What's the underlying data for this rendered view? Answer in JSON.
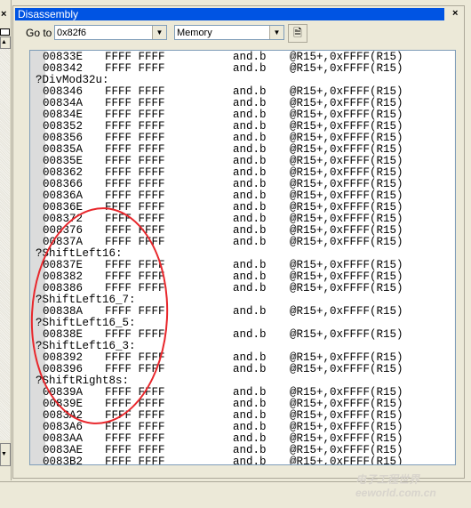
{
  "window": {
    "title": "Disassembly"
  },
  "toolbar": {
    "goto_label": "Go to",
    "goto_value": "0x82f6",
    "view_value": "Memory"
  },
  "colors": {
    "title_bar": "#0054e3",
    "annotation": "#e8262b"
  },
  "watermark": "eeworld.com.cn",
  "rows": [
    {
      "addr": "00833E",
      "hex": "FFFF FFFF",
      "op": "and.b",
      "args": "@R15+,0xFFFF(R15)"
    },
    {
      "addr": "008342",
      "hex": "FFFF FFFF",
      "op": "and.b",
      "args": "@R15+,0xFFFF(R15)"
    },
    {
      "label": "?DivMod32u:"
    },
    {
      "addr": "008346",
      "hex": "FFFF FFFF",
      "op": "and.b",
      "args": "@R15+,0xFFFF(R15)"
    },
    {
      "addr": "00834A",
      "hex": "FFFF FFFF",
      "op": "and.b",
      "args": "@R15+,0xFFFF(R15)"
    },
    {
      "addr": "00834E",
      "hex": "FFFF FFFF",
      "op": "and.b",
      "args": "@R15+,0xFFFF(R15)"
    },
    {
      "addr": "008352",
      "hex": "FFFF FFFF",
      "op": "and.b",
      "args": "@R15+,0xFFFF(R15)"
    },
    {
      "addr": "008356",
      "hex": "FFFF FFFF",
      "op": "and.b",
      "args": "@R15+,0xFFFF(R15)"
    },
    {
      "addr": "00835A",
      "hex": "FFFF FFFF",
      "op": "and.b",
      "args": "@R15+,0xFFFF(R15)"
    },
    {
      "addr": "00835E",
      "hex": "FFFF FFFF",
      "op": "and.b",
      "args": "@R15+,0xFFFF(R15)"
    },
    {
      "addr": "008362",
      "hex": "FFFF FFFF",
      "op": "and.b",
      "args": "@R15+,0xFFFF(R15)"
    },
    {
      "addr": "008366",
      "hex": "FFFF FFFF",
      "op": "and.b",
      "args": "@R15+,0xFFFF(R15)"
    },
    {
      "addr": "00836A",
      "hex": "FFFF FFFF",
      "op": "and.b",
      "args": "@R15+,0xFFFF(R15)"
    },
    {
      "addr": "00836E",
      "hex": "FFFF FFFF",
      "op": "and.b",
      "args": "@R15+,0xFFFF(R15)"
    },
    {
      "addr": "008372",
      "hex": "FFFF FFFF",
      "op": "and.b",
      "args": "@R15+,0xFFFF(R15)"
    },
    {
      "addr": "008376",
      "hex": "FFFF FFFF",
      "op": "and.b",
      "args": "@R15+,0xFFFF(R15)"
    },
    {
      "addr": "00837A",
      "hex": "FFFF FFFF",
      "op": "and.b",
      "args": "@R15+,0xFFFF(R15)"
    },
    {
      "label": "?ShiftLeft16:"
    },
    {
      "addr": "00837E",
      "hex": "FFFF FFFF",
      "op": "and.b",
      "args": "@R15+,0xFFFF(R15)"
    },
    {
      "addr": "008382",
      "hex": "FFFF FFFF",
      "op": "and.b",
      "args": "@R15+,0xFFFF(R15)"
    },
    {
      "addr": "008386",
      "hex": "FFFF FFFF",
      "op": "and.b",
      "args": "@R15+,0xFFFF(R15)"
    },
    {
      "label": "?ShiftLeft16_7:"
    },
    {
      "addr": "00838A",
      "hex": "FFFF FFFF",
      "op": "and.b",
      "args": "@R15+,0xFFFF(R15)"
    },
    {
      "label": "?ShiftLeft16_5:"
    },
    {
      "addr": "00838E",
      "hex": "FFFF FFFF",
      "op": "and.b",
      "args": "@R15+,0xFFFF(R15)"
    },
    {
      "label": "?ShiftLeft16_3:"
    },
    {
      "addr": "008392",
      "hex": "FFFF FFFF",
      "op": "and.b",
      "args": "@R15+,0xFFFF(R15)"
    },
    {
      "addr": "008396",
      "hex": "FFFF FFFF",
      "op": "and.b",
      "args": "@R15+,0xFFFF(R15)"
    },
    {
      "label": "?ShiftRight8s:"
    },
    {
      "addr": "00839A",
      "hex": "FFFF FFFF",
      "op": "and.b",
      "args": "@R15+,0xFFFF(R15)"
    },
    {
      "addr": "00839E",
      "hex": "FFFF FFFF",
      "op": "and.b",
      "args": "@R15+,0xFFFF(R15)"
    },
    {
      "addr": "0083A2",
      "hex": "FFFF FFFF",
      "op": "and.b",
      "args": "@R15+,0xFFFF(R15)"
    },
    {
      "addr": "0083A6",
      "hex": "FFFF FFFF",
      "op": "and.b",
      "args": "@R15+,0xFFFF(R15)"
    },
    {
      "addr": "0083AA",
      "hex": "FFFF FFFF",
      "op": "and.b",
      "args": "@R15+,0xFFFF(R15)"
    },
    {
      "addr": "0083AE",
      "hex": "FFFF FFFF",
      "op": "and.b",
      "args": "@R15+,0xFFFF(R15)"
    },
    {
      "addr": "0083B2",
      "hex": "FFFF FFFF",
      "op": "and.b",
      "args": "@R15+,0xFFFF(R15)"
    }
  ]
}
